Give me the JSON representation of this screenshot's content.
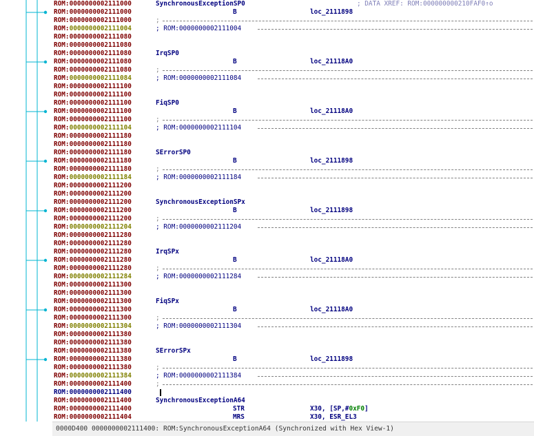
{
  "lines": [
    {
      "kind": "label",
      "addr": "0000000002111000",
      "label": "SynchronousExceptionSP0",
      "comment": "; DATA XREF: ROM:000000000210FAF0↑o"
    },
    {
      "kind": "instr",
      "addr": "0000000002111000",
      "mnem": "B",
      "oper": "loc_2111898"
    },
    {
      "kind": "sep",
      "addr": "0000000002111000"
    },
    {
      "kind": "comment",
      "addr": "0000000002111004",
      "text": "; ROM:0000000002111004",
      "olive": true
    },
    {
      "kind": "plain",
      "addr": "0000000002111080"
    },
    {
      "kind": "plain",
      "addr": "0000000002111080"
    },
    {
      "kind": "label",
      "addr": "0000000002111080",
      "label": "IrqSP0"
    },
    {
      "kind": "instr",
      "addr": "0000000002111080",
      "mnem": "B",
      "oper": "loc_21118A0"
    },
    {
      "kind": "sep",
      "addr": "0000000002111080"
    },
    {
      "kind": "comment",
      "addr": "0000000002111084",
      "text": "; ROM:0000000002111084",
      "olive": true
    },
    {
      "kind": "plain",
      "addr": "0000000002111100"
    },
    {
      "kind": "plain",
      "addr": "0000000002111100"
    },
    {
      "kind": "label",
      "addr": "0000000002111100",
      "label": "FiqSP0"
    },
    {
      "kind": "instr",
      "addr": "0000000002111100",
      "mnem": "B",
      "oper": "loc_21118A0"
    },
    {
      "kind": "sep",
      "addr": "0000000002111100"
    },
    {
      "kind": "comment",
      "addr": "0000000002111104",
      "text": "; ROM:0000000002111104",
      "olive": true
    },
    {
      "kind": "plain",
      "addr": "0000000002111180"
    },
    {
      "kind": "plain",
      "addr": "0000000002111180"
    },
    {
      "kind": "label",
      "addr": "0000000002111180",
      "label": "SErrorSP0"
    },
    {
      "kind": "instr",
      "addr": "0000000002111180",
      "mnem": "B",
      "oper": "loc_2111898"
    },
    {
      "kind": "sep",
      "addr": "0000000002111180"
    },
    {
      "kind": "comment",
      "addr": "0000000002111184",
      "text": "; ROM:0000000002111184",
      "olive": true
    },
    {
      "kind": "plain",
      "addr": "0000000002111200"
    },
    {
      "kind": "plain",
      "addr": "0000000002111200"
    },
    {
      "kind": "label",
      "addr": "0000000002111200",
      "label": "SynchronousExceptionSPx"
    },
    {
      "kind": "instr",
      "addr": "0000000002111200",
      "mnem": "B",
      "oper": "loc_2111898"
    },
    {
      "kind": "sep",
      "addr": "0000000002111200"
    },
    {
      "kind": "comment",
      "addr": "0000000002111204",
      "text": "; ROM:0000000002111204",
      "olive": true
    },
    {
      "kind": "plain",
      "addr": "0000000002111280"
    },
    {
      "kind": "plain",
      "addr": "0000000002111280"
    },
    {
      "kind": "label",
      "addr": "0000000002111280",
      "label": "IrqSPx"
    },
    {
      "kind": "instr",
      "addr": "0000000002111280",
      "mnem": "B",
      "oper": "loc_21118A0"
    },
    {
      "kind": "sep",
      "addr": "0000000002111280"
    },
    {
      "kind": "comment",
      "addr": "0000000002111284",
      "text": "; ROM:0000000002111284",
      "olive": true
    },
    {
      "kind": "plain",
      "addr": "0000000002111300"
    },
    {
      "kind": "plain",
      "addr": "0000000002111300"
    },
    {
      "kind": "label",
      "addr": "0000000002111300",
      "label": "FiqSPx"
    },
    {
      "kind": "instr",
      "addr": "0000000002111300",
      "mnem": "B",
      "oper": "loc_21118A0"
    },
    {
      "kind": "sep",
      "addr": "0000000002111300"
    },
    {
      "kind": "comment",
      "addr": "0000000002111304",
      "text": "; ROM:0000000002111304",
      "olive": true
    },
    {
      "kind": "plain",
      "addr": "0000000002111380"
    },
    {
      "kind": "plain",
      "addr": "0000000002111380"
    },
    {
      "kind": "label",
      "addr": "0000000002111380",
      "label": "SErrorSPx"
    },
    {
      "kind": "instr",
      "addr": "0000000002111380",
      "mnem": "B",
      "oper": "loc_2111898"
    },
    {
      "kind": "sep",
      "addr": "0000000002111380"
    },
    {
      "kind": "comment",
      "addr": "0000000002111384",
      "text": "; ROM:0000000002111384",
      "olive": true
    },
    {
      "kind": "sep2",
      "addr": "0000000002111400"
    },
    {
      "kind": "cursorline",
      "addr": "0000000002111400",
      "blue": true
    },
    {
      "kind": "label",
      "addr": "0000000002111400",
      "label": "SynchronousExceptionA64"
    },
    {
      "kind": "instr",
      "addr": "0000000002111400",
      "mnem": "STR",
      "oper": "X30, [SP,#",
      "imm": "0xF0",
      "tail": "]"
    },
    {
      "kind": "instr",
      "addr": "0000000002111404",
      "mnem": "MRS",
      "oper": "X30, ESR_EL3"
    }
  ],
  "segment_prefix": "ROM:",
  "status": "0000D400 0000000002111400: ROM:SynchronousExceptionA64 (Synchronized with Hex View-1)",
  "colors": {
    "flow_arrows": "#00b4d2",
    "address": "#7f0000",
    "olive_address": "#808000",
    "name": "#00007f"
  }
}
